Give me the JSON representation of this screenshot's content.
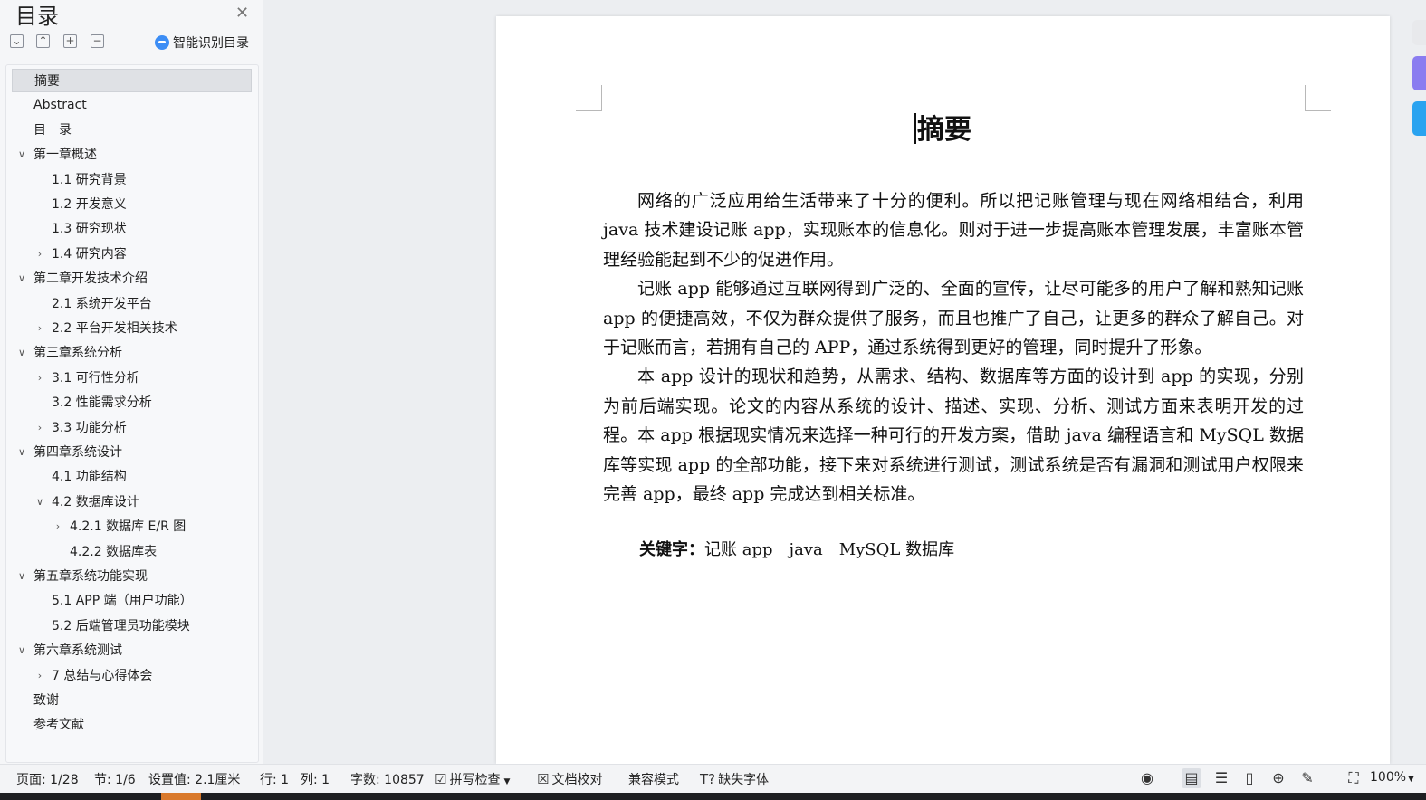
{
  "toc": {
    "title": "目录",
    "smart_toc_label": "智能识别目录",
    "items": [
      {
        "label": "摘要",
        "expander": ""
      },
      {
        "label": "Abstract",
        "expander": ""
      },
      {
        "label": "目　录",
        "expander": ""
      },
      {
        "label": "第一章概述",
        "expander": "expanded"
      },
      {
        "label": "1.1 研究背景",
        "expander": ""
      },
      {
        "label": "1.2 开发意义",
        "expander": ""
      },
      {
        "label": "1.3 研究现状",
        "expander": ""
      },
      {
        "label": "1.4 研究内容",
        "expander": "collapsed"
      },
      {
        "label": " 第二章开发技术介绍",
        "expander": "expanded"
      },
      {
        "label": "2.1  系统开发平台",
        "expander": ""
      },
      {
        "label": "2.2  平台开发相关技术",
        "expander": "collapsed"
      },
      {
        "label": "第三章系统分析",
        "expander": "expanded"
      },
      {
        "label": "3.1  可行性分析",
        "expander": "collapsed"
      },
      {
        "label": "3.2 性能需求分析",
        "expander": ""
      },
      {
        "label": "3.3 功能分析",
        "expander": "collapsed"
      },
      {
        "label": "第四章系统设计",
        "expander": "expanded"
      },
      {
        "label": "4.1 功能结构",
        "expander": ""
      },
      {
        "label": "4.2 数据库设计",
        "expander": "expanded"
      },
      {
        "label": "4.2.1  数据库 E/R 图",
        "expander": "collapsed"
      },
      {
        "label": "4.2.2 数据库表",
        "expander": ""
      },
      {
        "label": "第五章系统功能实现",
        "expander": "expanded"
      },
      {
        "label": "5.1 APP 端（用户功能）",
        "expander": ""
      },
      {
        "label": "5.2 后端管理员功能模块",
        "expander": ""
      },
      {
        "label": "第六章系统测试",
        "expander": "expanded"
      },
      {
        "label": "7 总结与心得体会",
        "expander": "collapsed"
      },
      {
        "label": "致谢",
        "expander": ""
      },
      {
        "label": "参考文献",
        "expander": ""
      }
    ]
  },
  "document": {
    "heading": "摘要",
    "paragraphs": [
      "网络的广泛应用给生活带来了十分的便利。所以把记账管理与现在网络相结合，利用java 技术建设记账 app，实现账本的信息化。则对于进一步提高账本管理发展，丰富账本管理经验能起到不少的促进作用。",
      "记账 app 能够通过互联网得到广泛的、全面的宣传，让尽可能多的用户了解和熟知记账 app 的便捷高效，不仅为群众提供了服务，而且也推广了自己，让更多的群众了解自己。对于记账而言，若拥有自己的 APP，通过系统得到更好的管理，同时提升了形象。",
      "本 app 设计的现状和趋势，从需求、结构、数据库等方面的设计到 app 的实现，分别为前后端实现。论文的内容从系统的设计、描述、实现、分析、测试方面来表明开发的过程。本 app 根据现实情况来选择一种可行的开发方案，借助 java 编程语言和 MySQL 数据库等实现 app 的全部功能，接下来对系统进行测试，测试系统是否有漏洞和测试用户权限来完善 app，最终 app 完成达到相关标准。"
    ],
    "keywords_label": "关键字：",
    "keywords_value": "记账 app　java　MySQL 数据库"
  },
  "statusbar": {
    "page": "页面: 1/28",
    "section": "节: 1/6",
    "setting": "设置值: 2.1厘米",
    "row": "行: 1",
    "col": "列: 1",
    "word_count": "字数: 10857",
    "spell_check": "拼写检查",
    "proofread": "文档校对",
    "compat_mode": "兼容模式",
    "missing_fonts": "缺失字体",
    "zoom": "100%"
  },
  "colors": {
    "accent_blue": "#3c8df5",
    "side_tab_purple": "#8a7cf0",
    "side_tab_blue": "#2aa3f0",
    "taskbar_accent": "#d9792b"
  }
}
